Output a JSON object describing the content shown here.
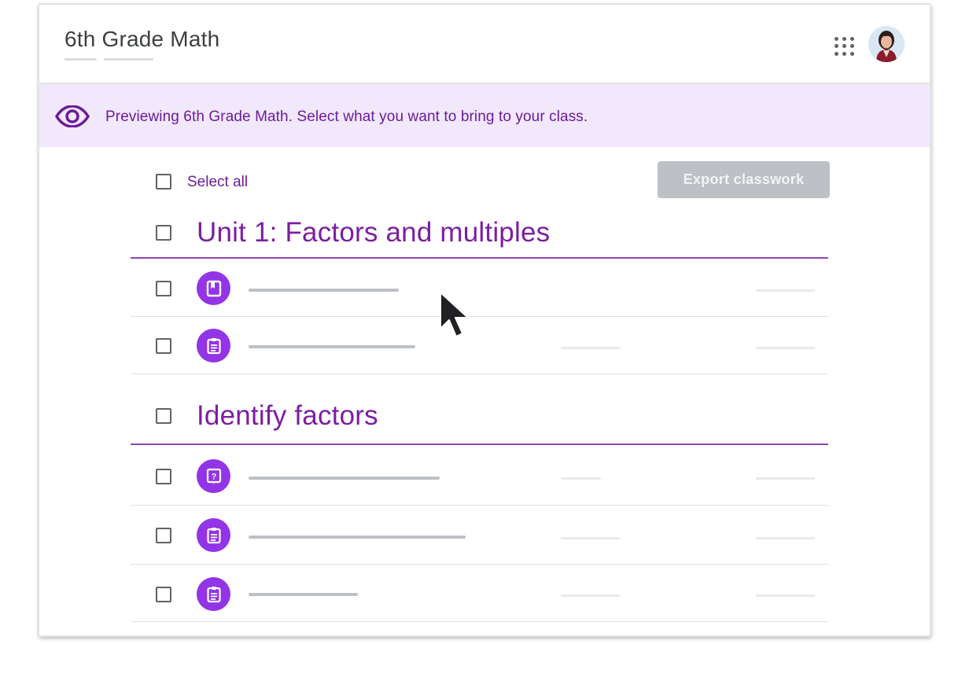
{
  "header": {
    "course_title": "6th Grade Math"
  },
  "banner": {
    "text": "Previewing 6th Grade Math. Select what you want to bring to your class."
  },
  "toolbar": {
    "select_all_label": "Select all",
    "export_label": "Export classwork"
  },
  "topics": [
    {
      "title": "Unit 1: Factors and multiples",
      "items": [
        {
          "icon": "material-icon"
        },
        {
          "icon": "assignment-icon"
        }
      ]
    },
    {
      "title": "Identify factors",
      "items": [
        {
          "icon": "question-icon"
        },
        {
          "icon": "assignment-icon"
        },
        {
          "icon": "assignment-icon"
        }
      ]
    }
  ],
  "colors": {
    "accent": "#9334e6",
    "banner_bg": "#f2e8fb",
    "topic_text": "#7b1fa2",
    "disabled_button": "#bdc1c6"
  }
}
